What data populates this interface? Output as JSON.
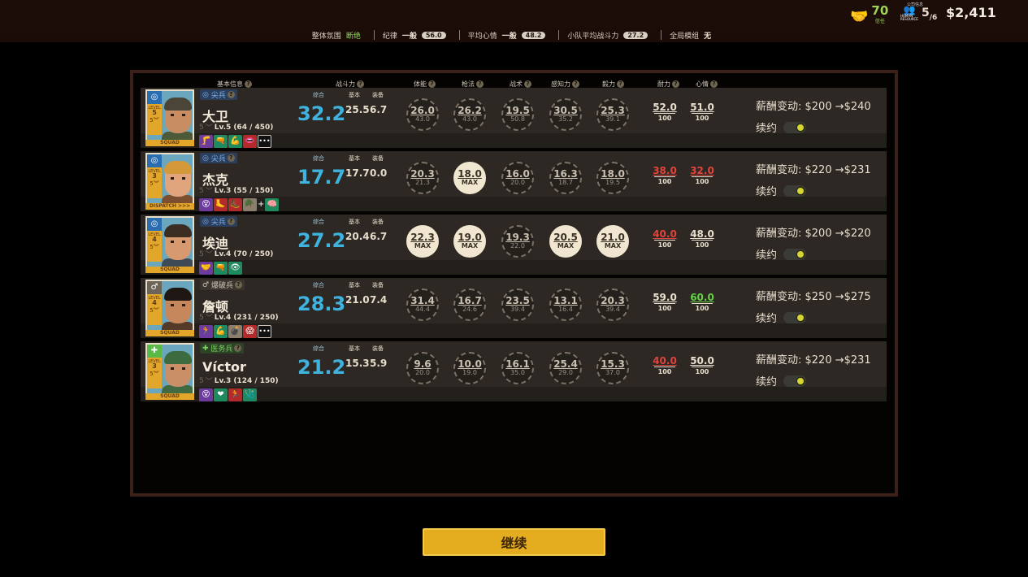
{
  "top": {
    "trust_value": "70",
    "trust_label": "信任",
    "hr_top_label": "公司信息",
    "hr_icon_label": "HUMAN RESOURCE",
    "hr_value": "5",
    "hr_max": "/6",
    "money": "$2,411"
  },
  "status": {
    "atmosphere_label": "整体氛围",
    "atmosphere_value": "断绝",
    "discipline_label": "纪律",
    "discipline_value": "一般",
    "discipline_num": "56.0",
    "mood_label": "平均心情",
    "mood_value": "一般",
    "mood_num": "48.2",
    "squad_power_label": "小队平均战斗力",
    "squad_power_num": "27.2",
    "module_label": "全局模组",
    "module_value": "无"
  },
  "headers": {
    "basic": "基本信息",
    "combat": "战斗力",
    "fitness": "体能",
    "marksman": "枪法",
    "tactics": "战术",
    "perception": "感知力",
    "grit": "毅力",
    "stamina": "耐力",
    "mood": "心情"
  },
  "combat_tags": {
    "total": "综合",
    "base": "基本",
    "gear": "装备"
  },
  "renew_label": "续约",
  "soldiers": [
    {
      "name": "大卫",
      "class": "尖兵",
      "class_icon": "target-icon",
      "level_label": "LEVEL",
      "level": "5",
      "lvl_prefix": "5",
      "lvl": "Lv.5",
      "xp": "(64 / 450)",
      "tag": "SQUAD",
      "skills": [
        [
          "p",
          "🦵"
        ],
        [
          "g",
          "🔫"
        ],
        [
          "g",
          "💪"
        ],
        [
          "r",
          "👄"
        ]
      ],
      "plus": "",
      "more": "•••",
      "total": "32.2",
      "base": "25.5",
      "gear": "6.7",
      "stats": [
        [
          "26.0",
          "43.0",
          false
        ],
        [
          "26.2",
          "43.0",
          false
        ],
        [
          "19.5",
          "50.8",
          false
        ],
        [
          "30.5",
          "35.2",
          false
        ],
        [
          "25.3",
          "39.1",
          false
        ]
      ],
      "stamina": [
        "52.0",
        "100",
        ""
      ],
      "mood": [
        "51.0",
        "100",
        ""
      ],
      "salary": "薪酬变动: $200 →$240"
    },
    {
      "name": "杰克",
      "class": "尖兵",
      "class_icon": "target-icon",
      "level_label": "LEVEL",
      "level": "3",
      "lvl_prefix": "5",
      "lvl": "Lv.3",
      "xp": "(55 / 150)",
      "tag": "DISPATCH >>>",
      "skills": [
        [
          "p",
          "😵"
        ],
        [
          "r",
          "🦶"
        ],
        [
          "r",
          "🥾"
        ],
        [
          "t",
          "🪖"
        ]
      ],
      "plus": "+",
      "more": "",
      "extra_skill": [
        "g",
        "🧠"
      ],
      "total": "17.7",
      "base": "17.7",
      "gear": "0.0",
      "stats": [
        [
          "20.3",
          "21.3",
          false
        ],
        [
          "18.0",
          "MAX",
          true
        ],
        [
          "16.0",
          "20.0",
          false
        ],
        [
          "16.3",
          "18.7",
          false
        ],
        [
          "18.0",
          "19.5",
          false
        ]
      ],
      "stamina": [
        "38.0",
        "100",
        "red"
      ],
      "mood": [
        "32.0",
        "100",
        "red"
      ],
      "salary": "薪酬变动: $220 →$231"
    },
    {
      "name": "埃迪",
      "class": "尖兵",
      "class_icon": "target-icon",
      "level_label": "LEVEL",
      "level": "4",
      "lvl_prefix": "5",
      "lvl": "Lv.4",
      "xp": "(70 / 250)",
      "tag": "SQUAD",
      "skills": [
        [
          "p",
          "🤝"
        ],
        [
          "g",
          "🔫"
        ],
        [
          "g",
          "👁"
        ]
      ],
      "plus": "",
      "more": "",
      "total": "27.2",
      "base": "20.4",
      "gear": "6.7",
      "stats": [
        [
          "22.3",
          "MAX",
          true
        ],
        [
          "19.0",
          "MAX",
          true
        ],
        [
          "19.3",
          "22.0",
          false
        ],
        [
          "20.5",
          "MAX",
          true
        ],
        [
          "21.0",
          "MAX",
          true
        ]
      ],
      "stamina": [
        "40.0",
        "100",
        "red"
      ],
      "mood": [
        "48.0",
        "100",
        ""
      ],
      "salary": "薪酬变动: $200 →$220"
    },
    {
      "name": "詹顿",
      "class": "爆破兵",
      "class_icon": "blast-icon",
      "level_label": "LEVEL",
      "level": "4",
      "lvl_prefix": "5",
      "lvl": "Lv.4",
      "xp": "(231 / 250)",
      "tag": "SQUAD",
      "skills": [
        [
          "p",
          "🏃"
        ],
        [
          "g",
          "💪"
        ],
        [
          "t",
          "💣"
        ],
        [
          "r",
          "😱"
        ]
      ],
      "plus": "",
      "more": "•••",
      "total": "28.3",
      "base": "21.0",
      "gear": "7.4",
      "stats": [
        [
          "31.4",
          "44.4",
          false
        ],
        [
          "16.7",
          "24.6",
          false
        ],
        [
          "23.5",
          "39.4",
          false
        ],
        [
          "13.1",
          "16.4",
          false
        ],
        [
          "20.3",
          "39.4",
          false
        ]
      ],
      "stamina": [
        "59.0",
        "100",
        ""
      ],
      "mood": [
        "60.0",
        "100",
        "green"
      ],
      "salary": "薪酬变动: $250 →$275"
    },
    {
      "name": "Víctor",
      "class": "医务兵",
      "class_icon": "medic-cross-icon",
      "level_label": "LEVEL",
      "level": "3",
      "lvl_prefix": "5",
      "lvl": "Lv.3",
      "xp": "(124 / 150)",
      "tag": "SQUAD",
      "skills": [
        [
          "p",
          "😵"
        ],
        [
          "g",
          "❤"
        ],
        [
          "r",
          "🏃"
        ],
        [
          "g",
          "🩺"
        ]
      ],
      "plus": "",
      "more": "",
      "total": "21.2",
      "base": "15.3",
      "gear": "5.9",
      "stats": [
        [
          "9.6",
          "20.0",
          false
        ],
        [
          "10.0",
          "19.0",
          false
        ],
        [
          "16.1",
          "35.0",
          false
        ],
        [
          "25.4",
          "29.0",
          false
        ],
        [
          "15.3",
          "37.0",
          false
        ]
      ],
      "stamina": [
        "40.0",
        "100",
        "red"
      ],
      "mood": [
        "50.0",
        "100",
        ""
      ],
      "salary": "薪酬变动: $220 →$231"
    }
  ],
  "continue_label": "继续",
  "colors": {
    "accent": "#e3ad1f",
    "combat_blue": "#3fb3de",
    "danger": "#e0443c",
    "good": "#65d046"
  }
}
